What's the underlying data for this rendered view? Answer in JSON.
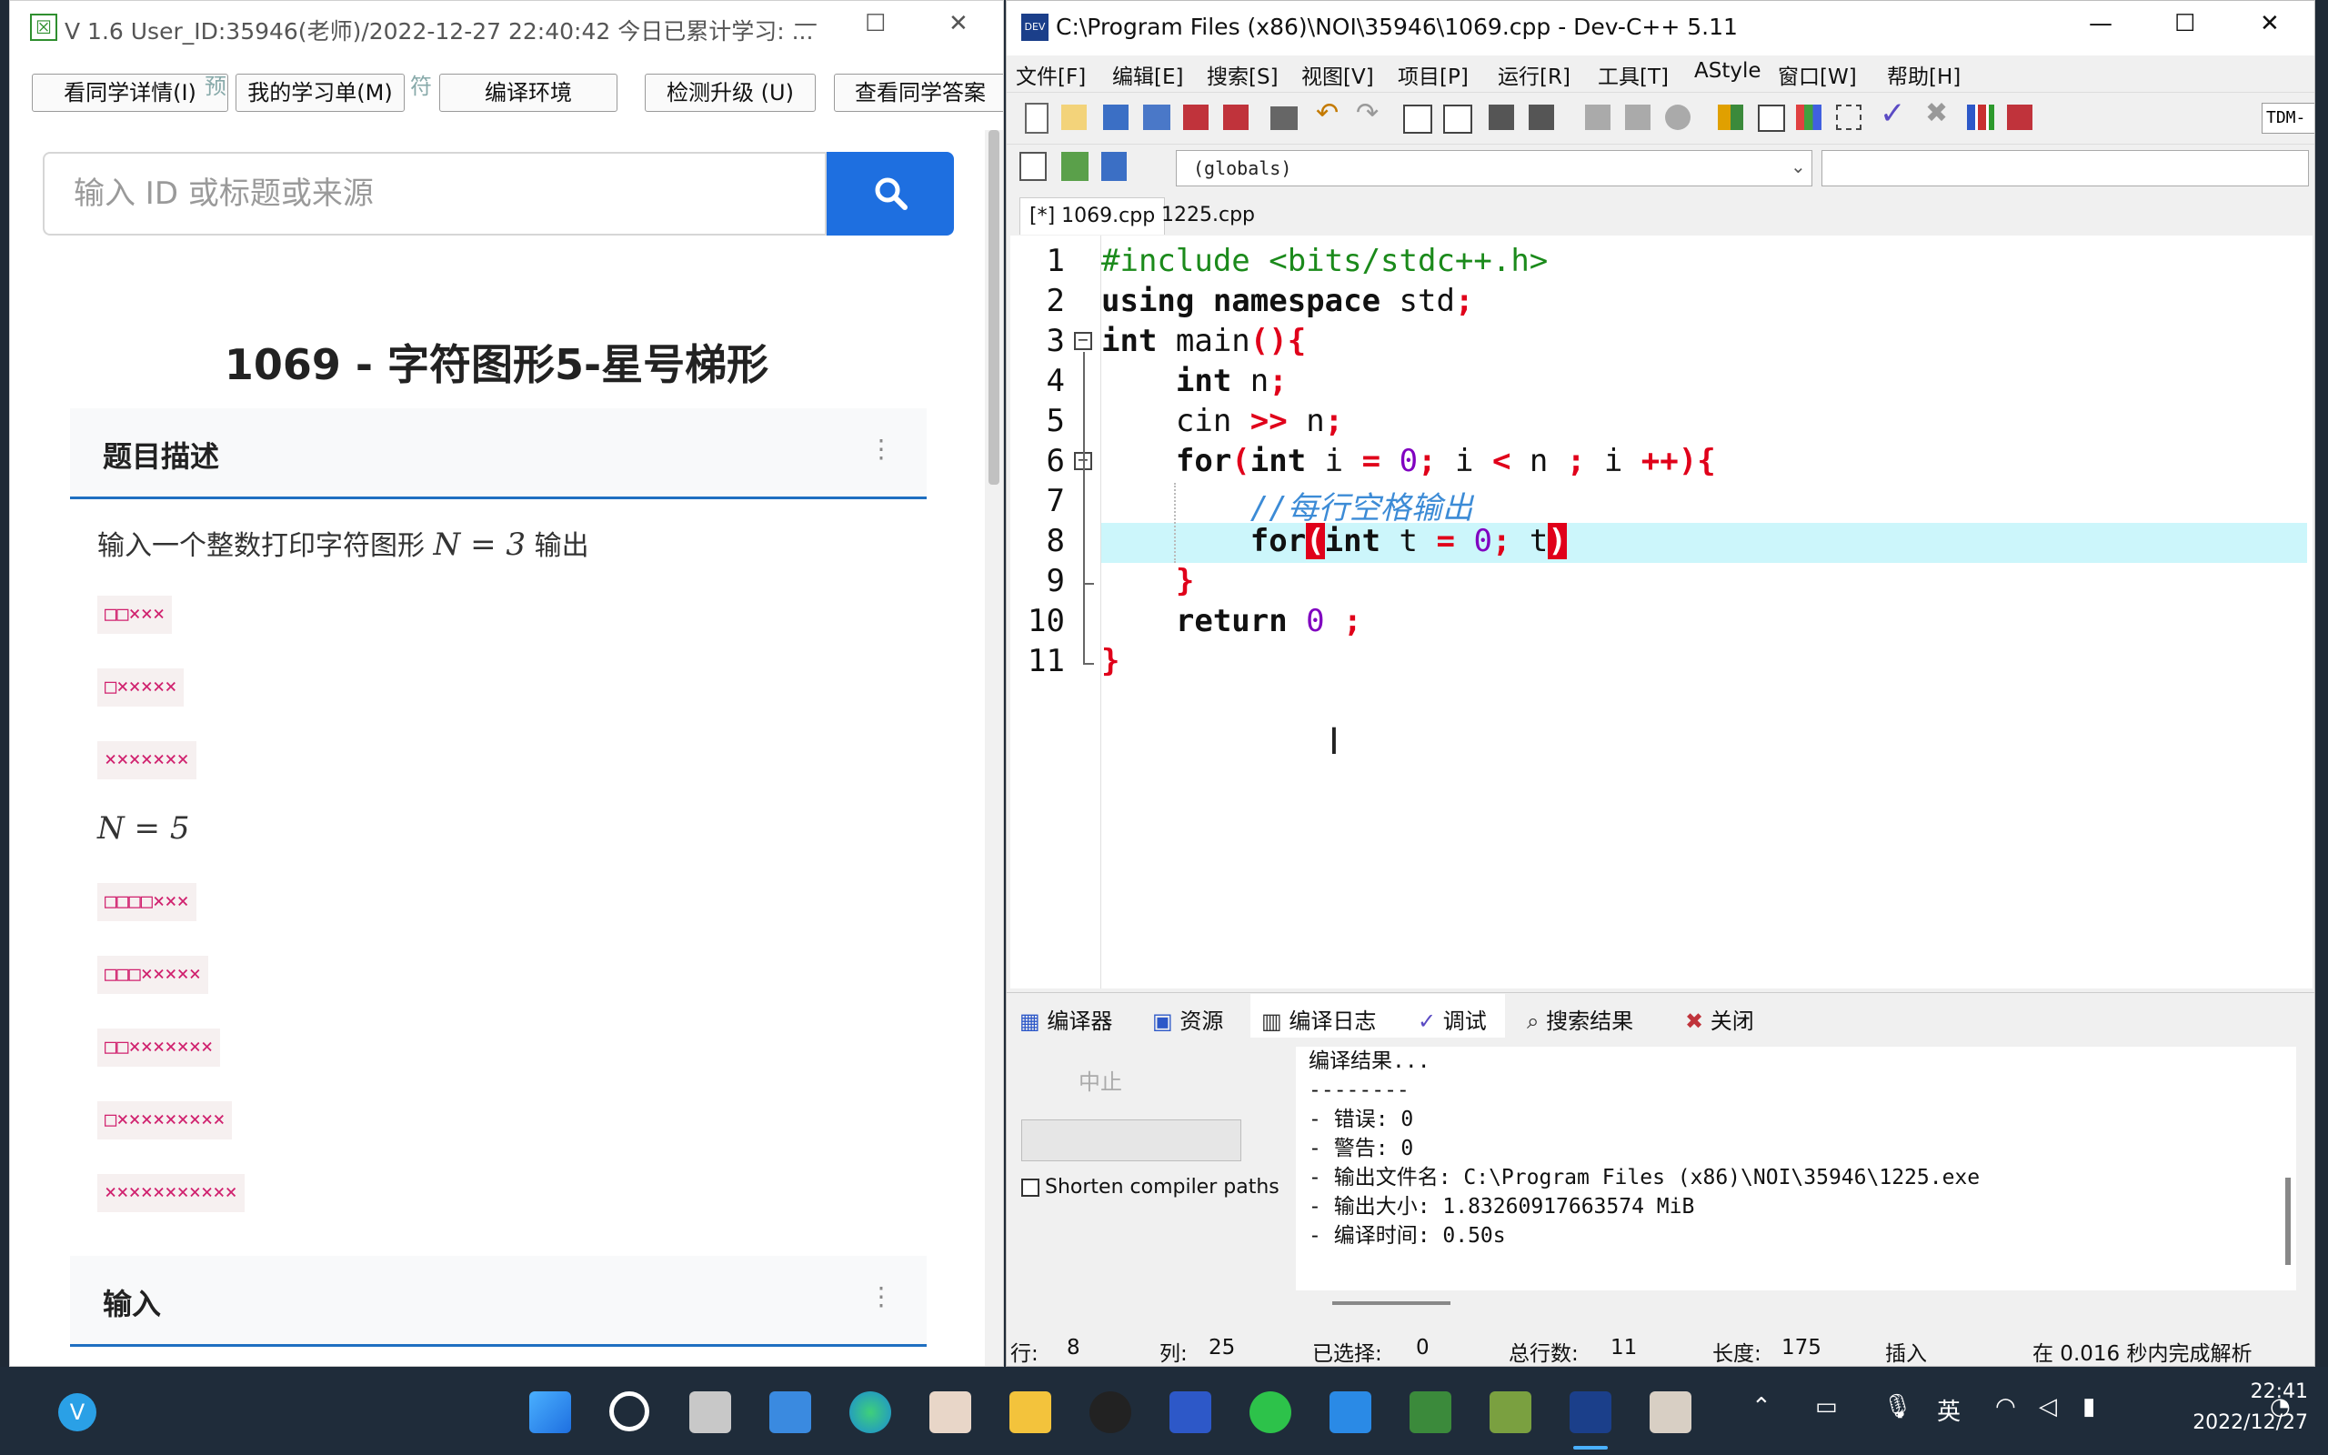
{
  "left_window": {
    "title": "V 1.6 User_ID:35946(老师)/2022-12-27 22:40:42 今日已累计学习: ...",
    "toolbar": {
      "peer_details": "看同学详情(I)",
      "my_list": "我的学习单(M)",
      "compile_env": "编译环境",
      "check_update": "检测升级 (U)",
      "peer_answer": "查看同学答案",
      "faded_1": "预",
      "faded_2": "符"
    },
    "search": {
      "placeholder": "输入 ID 或标题或来源"
    },
    "problem": {
      "title": "1069 - 字符图形5-星号梯形",
      "desc_heading": "题目描述",
      "desc_text": "输入一个整数打印字符图形",
      "n_eq_3": "N = 3",
      "output_word": "输出",
      "sample_3": [
        "□□×××",
        "□×××××",
        "×××××××"
      ],
      "n_eq_5": "N = 5",
      "sample_5": [
        "□□□□×××",
        "□□□×××××",
        "□□×××××××",
        "□×××××××××",
        "×××××××××××"
      ],
      "input_heading": "输入"
    }
  },
  "right_window": {
    "title": "C:\\Program Files (x86)\\NOI\\35946\\1069.cpp - Dev-C++ 5.11",
    "menu": [
      "文件[F]",
      "编辑[E]",
      "搜索[S]",
      "视图[V]",
      "项目[P]",
      "运行[R]",
      "工具[T]",
      "AStyle",
      "窗口[W]",
      "帮助[H]"
    ],
    "compiler_label": "TDM-",
    "scope_combo": "(globals)",
    "tabs": [
      "[*] 1069.cpp",
      "1225.cpp"
    ],
    "line_numbers": [
      "1",
      "2",
      "3",
      "4",
      "5",
      "6",
      "7",
      "8",
      "9",
      "10",
      "11"
    ],
    "code": {
      "l1": "#include <bits/stdc++.h>",
      "l2a": "using namespace",
      "l2b": " std",
      "l2c": ";",
      "l3a": "int",
      "l3b": " main",
      "l3c": "(){",
      "l4a": "    int",
      "l4b": " n",
      "l4c": ";",
      "l5a": "    cin ",
      "l5b": ">>",
      "l5c": " n",
      "l5d": ";",
      "l6a": "    for",
      "l6b": "(",
      "l6c": "int",
      "l6d": " i ",
      "l6e": "=",
      "l6f": " 0",
      "l6g": ";",
      "l6h": " i ",
      "l6i": "<",
      "l6j": " n ",
      "l6k": ";",
      "l6l": " i ",
      "l6m": "++){",
      "l7": "        //每行空格输出",
      "l8a": "        for",
      "l8b": "(",
      "l8c": "int",
      "l8d": " t ",
      "l8e": "=",
      "l8f": " 0",
      "l8g": ";",
      "l8h": " t",
      "l8i": ")",
      "l9": "    }",
      "l10a": "    return",
      "l10b": " 0",
      "l10c": " ;",
      "l11": "}"
    },
    "bottom_tabs": [
      "编译器",
      "资源",
      "编译日志",
      "调试",
      "搜索结果",
      "关闭"
    ],
    "abort_label": "中止",
    "shorten_paths": "Shorten compiler paths",
    "log_lines": [
      "编译结果...",
      "--------",
      "- 错误: 0",
      "- 警告: 0",
      "- 输出文件名: C:\\Program Files (x86)\\NOI\\35946\\1225.exe",
      "- 输出大小: 1.83260917663574 MiB",
      "- 编译时间: 0.50s"
    ],
    "status": {
      "row_label": "行:",
      "row": "8",
      "col_label": "列:",
      "col": "25",
      "sel_label": "已选择:",
      "sel": "0",
      "total_label": "总行数:",
      "total": "11",
      "len_label": "长度:",
      "len": "175",
      "mode": "插入",
      "parse": "在 0.016 秒内完成解析"
    }
  },
  "taskbar": {
    "ime": "英",
    "time": "22:41",
    "date": "2022/12/27"
  },
  "colors": {
    "accent_blue": "#1e6fe0",
    "highlight_line": "#ccf6fb",
    "keyword_red": "#e0001a",
    "taskbar": "#1f2c3a"
  }
}
